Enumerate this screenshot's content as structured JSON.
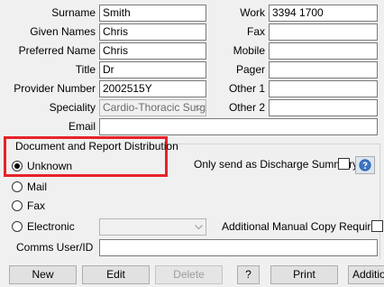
{
  "form": {
    "surname_label": "Surname",
    "surname_value": "Smith",
    "given_names_label": "Given Names",
    "given_names_value": "Chris",
    "preferred_name_label": "Preferred Name",
    "preferred_name_value": "Chris",
    "title_label": "Title",
    "title_value": "Dr",
    "provider_number_label": "Provider Number",
    "provider_number_value": "2002515Y",
    "speciality_label": "Speciality",
    "speciality_value": "Cardio-Thoracic Surg",
    "email_label": "Email",
    "email_value": "",
    "work_label": "Work",
    "work_value": "3394 1700",
    "fax_label": "Fax",
    "fax_value": "",
    "mobile_label": "Mobile",
    "mobile_value": "",
    "pager_label": "Pager",
    "pager_value": "",
    "other1_label": "Other 1",
    "other1_value": "",
    "other2_label": "Other 2",
    "other2_value": ""
  },
  "distribution": {
    "group_title": "Document and Report Distribution",
    "options": [
      "Unknown",
      "Mail",
      "Fax",
      "Electronic"
    ],
    "selected": "Unknown",
    "discharge_summary_label": "Only send as Discharge Summary",
    "discharge_summary_checked": false,
    "additional_copy_label": "Additional Manual Copy Required",
    "additional_copy_checked": false,
    "electronic_value": "",
    "comms_user_label": "Comms User/ID",
    "comms_user_value": "",
    "highlight_color": "#e8222a"
  },
  "buttons": {
    "new": "New",
    "edit": "Edit",
    "delete": "Delete",
    "help": "?",
    "print": "Print",
    "additional": "Additional"
  },
  "icons": {
    "help_icon": "question-circle-icon",
    "combo_arrow": "chevron-down-icon"
  }
}
